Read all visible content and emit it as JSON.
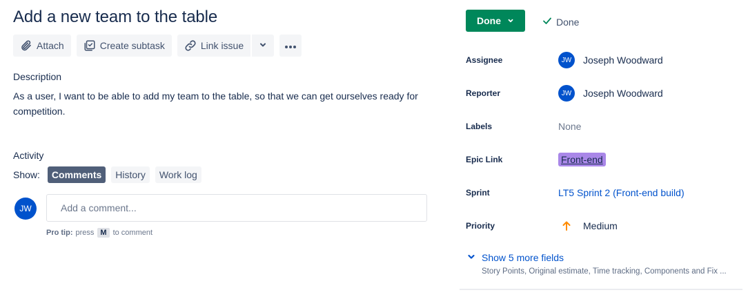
{
  "issue": {
    "title": "Add a new team to the table"
  },
  "toolbar": {
    "attach_label": "Attach",
    "subtask_label": "Create subtask",
    "link_label": "Link issue"
  },
  "description": {
    "heading": "Description",
    "text": "As a user, I want to be able to add my team to the table, so that we can get ourselves ready for competition."
  },
  "activity": {
    "heading": "Activity",
    "show_label": "Show:",
    "tabs": [
      {
        "label": "Comments",
        "active": true
      },
      {
        "label": "History",
        "active": false
      },
      {
        "label": "Work log",
        "active": false
      }
    ],
    "avatar_initials": "JW",
    "comment_placeholder": "Add a comment...",
    "protip_label": "Pro tip:",
    "protip_pre": "press",
    "protip_key": "M",
    "protip_post": "to comment"
  },
  "status": {
    "button_label": "Done",
    "resolution": "Done",
    "color": "#00875a"
  },
  "fields": {
    "assignee": {
      "label": "Assignee",
      "initials": "JW",
      "name": "Joseph Woodward"
    },
    "reporter": {
      "label": "Reporter",
      "initials": "JW",
      "name": "Joseph Woodward"
    },
    "labels": {
      "label": "Labels",
      "value": "None"
    },
    "epic": {
      "label": "Epic Link",
      "value": "Front-end",
      "color": "#a987e8"
    },
    "sprint": {
      "label": "Sprint",
      "value": "LT5 Sprint 2 (Front-end build)"
    },
    "priority": {
      "label": "Priority",
      "value": "Medium",
      "icon": "arrow-up-icon",
      "icon_color": "#ff8b00"
    }
  },
  "more_fields": {
    "label": "Show 5 more fields",
    "summary": "Story Points, Original estimate, Time tracking, Components and Fix ..."
  }
}
